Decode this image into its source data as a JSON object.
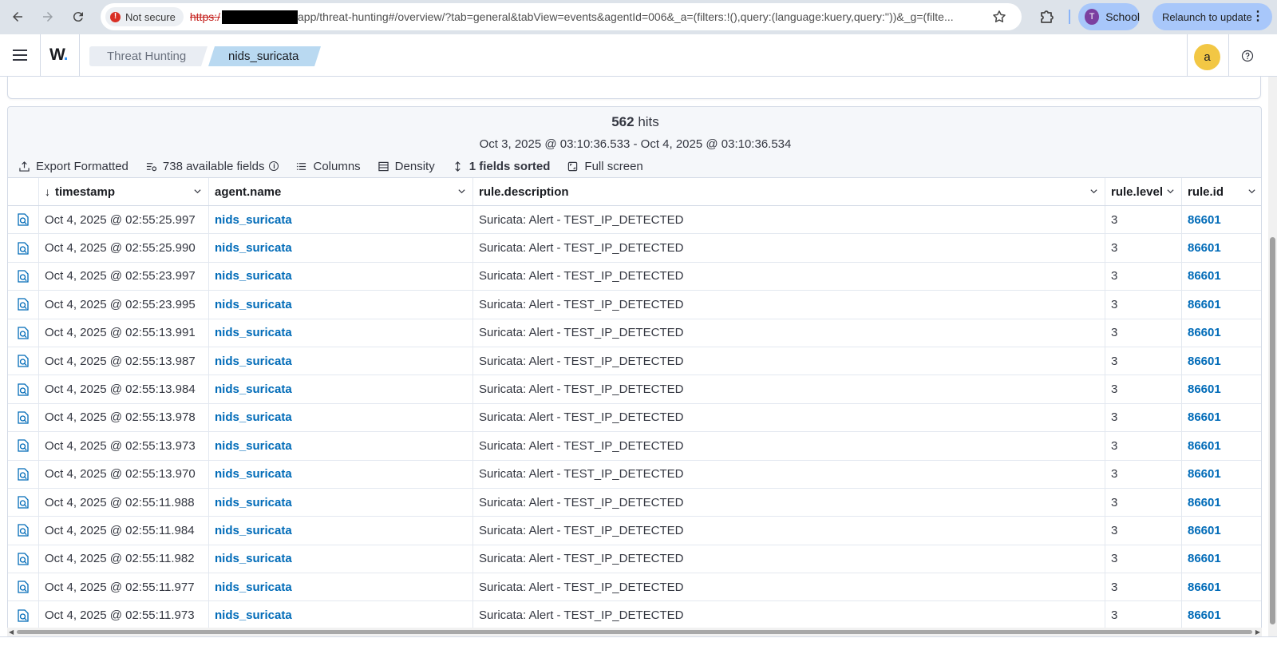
{
  "browser": {
    "security_label": "Not secure",
    "url_scheme": "https:/",
    "url_rest": "app/threat-hunting#/overview/?tab=general&tabView=events&agentId=006&_a=(filters:!(),query:(language:kuery,query:''))&_g=(filte...",
    "profile_initial": "T",
    "profile_name": "School",
    "relaunch_label": "Relaunch to update"
  },
  "header": {
    "breadcrumbs": [
      "Threat Hunting",
      "nids_suricata"
    ],
    "user_initial": "a"
  },
  "results": {
    "hits_count": "562",
    "hits_label": "hits",
    "time_range": "Oct 3, 2025 @ 03:10:36.533 - Oct 4, 2025 @ 03:10:36.534",
    "toolbar": {
      "export": "Export Formatted",
      "fields": "738 available fields",
      "columns": "Columns",
      "density": "Density",
      "sorted": "1 fields sorted",
      "fullscreen": "Full screen"
    },
    "columns": [
      "timestamp",
      "agent.name",
      "rule.description",
      "rule.level",
      "rule.id"
    ],
    "rows": [
      {
        "timestamp": "Oct 4, 2025 @ 02:55:25.997",
        "agent": "nids_suricata",
        "desc": "Suricata: Alert - TEST_IP_DETECTED",
        "level": "3",
        "id": "86601"
      },
      {
        "timestamp": "Oct 4, 2025 @ 02:55:25.990",
        "agent": "nids_suricata",
        "desc": "Suricata: Alert - TEST_IP_DETECTED",
        "level": "3",
        "id": "86601"
      },
      {
        "timestamp": "Oct 4, 2025 @ 02:55:23.997",
        "agent": "nids_suricata",
        "desc": "Suricata: Alert - TEST_IP_DETECTED",
        "level": "3",
        "id": "86601"
      },
      {
        "timestamp": "Oct 4, 2025 @ 02:55:23.995",
        "agent": "nids_suricata",
        "desc": "Suricata: Alert - TEST_IP_DETECTED",
        "level": "3",
        "id": "86601"
      },
      {
        "timestamp": "Oct 4, 2025 @ 02:55:13.991",
        "agent": "nids_suricata",
        "desc": "Suricata: Alert - TEST_IP_DETECTED",
        "level": "3",
        "id": "86601"
      },
      {
        "timestamp": "Oct 4, 2025 @ 02:55:13.987",
        "agent": "nids_suricata",
        "desc": "Suricata: Alert - TEST_IP_DETECTED",
        "level": "3",
        "id": "86601"
      },
      {
        "timestamp": "Oct 4, 2025 @ 02:55:13.984",
        "agent": "nids_suricata",
        "desc": "Suricata: Alert - TEST_IP_DETECTED",
        "level": "3",
        "id": "86601"
      },
      {
        "timestamp": "Oct 4, 2025 @ 02:55:13.978",
        "agent": "nids_suricata",
        "desc": "Suricata: Alert - TEST_IP_DETECTED",
        "level": "3",
        "id": "86601"
      },
      {
        "timestamp": "Oct 4, 2025 @ 02:55:13.973",
        "agent": "nids_suricata",
        "desc": "Suricata: Alert - TEST_IP_DETECTED",
        "level": "3",
        "id": "86601"
      },
      {
        "timestamp": "Oct 4, 2025 @ 02:55:13.970",
        "agent": "nids_suricata",
        "desc": "Suricata: Alert - TEST_IP_DETECTED",
        "level": "3",
        "id": "86601"
      },
      {
        "timestamp": "Oct 4, 2025 @ 02:55:11.988",
        "agent": "nids_suricata",
        "desc": "Suricata: Alert - TEST_IP_DETECTED",
        "level": "3",
        "id": "86601"
      },
      {
        "timestamp": "Oct 4, 2025 @ 02:55:11.984",
        "agent": "nids_suricata",
        "desc": "Suricata: Alert - TEST_IP_DETECTED",
        "level": "3",
        "id": "86601"
      },
      {
        "timestamp": "Oct 4, 2025 @ 02:55:11.982",
        "agent": "nids_suricata",
        "desc": "Suricata: Alert - TEST_IP_DETECTED",
        "level": "3",
        "id": "86601"
      },
      {
        "timestamp": "Oct 4, 2025 @ 02:55:11.977",
        "agent": "nids_suricata",
        "desc": "Suricata: Alert - TEST_IP_DETECTED",
        "level": "3",
        "id": "86601"
      },
      {
        "timestamp": "Oct 4, 2025 @ 02:55:11.973",
        "agent": "nids_suricata",
        "desc": "Suricata: Alert - TEST_IP_DETECTED",
        "level": "3",
        "id": "86601"
      }
    ]
  },
  "icons": {
    "back": "arrow-left-icon",
    "forward": "arrow-right-icon",
    "reload": "reload-icon",
    "bookmark": "star-icon",
    "extensions": "puzzle-icon",
    "menu": "hamburger-icon",
    "help": "help-icon",
    "row_action": "inspect-document-icon"
  },
  "colors": {
    "link": "#006bb8",
    "active_breadcrumb": "#b9d9f1",
    "chrome_bg": "#dde3ea",
    "chip": "#a8c7fa",
    "avatar": "#f2c744"
  }
}
